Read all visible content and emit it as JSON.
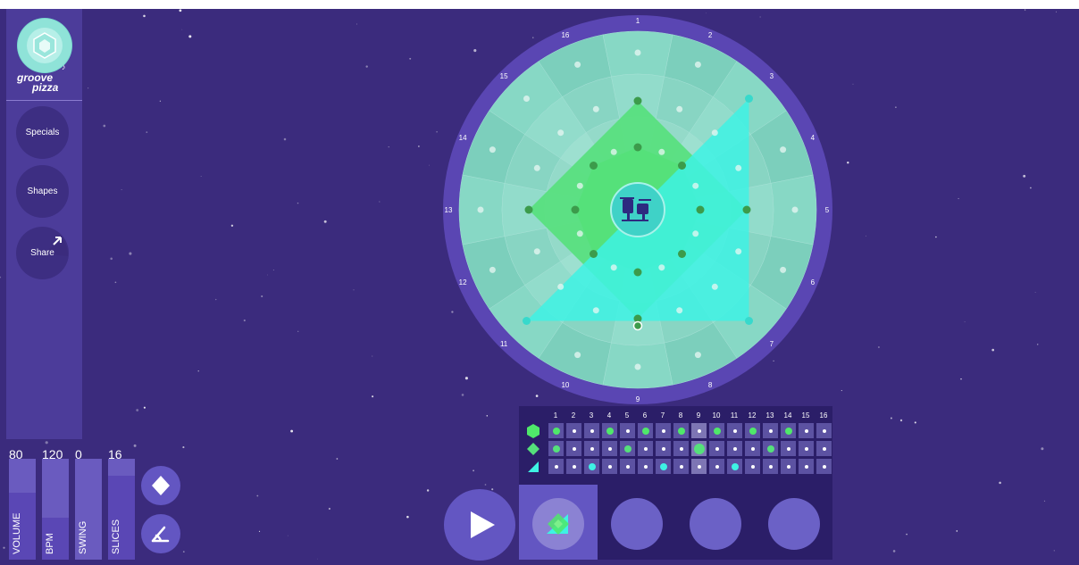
{
  "app": {
    "logo_line1": "groove",
    "logo_line2": "pizza"
  },
  "sidebar": {
    "buttons": [
      {
        "label": "Specials"
      },
      {
        "label": "Shapes"
      },
      {
        "label": "Share"
      }
    ]
  },
  "sliders": [
    {
      "label": "VOLUME",
      "value": "80",
      "level": 0.8
    },
    {
      "label": "BPM",
      "value": "120",
      "level": 0.5
    },
    {
      "label": "SWING",
      "value": "0",
      "level": 0.0
    },
    {
      "label": "SLICES",
      "value": "16",
      "level": 1.0
    }
  ],
  "shape_buttons": [
    {
      "icon": "diamond-icon"
    },
    {
      "icon": "triangle-icon"
    }
  ],
  "pizza": {
    "slices": 16,
    "slice_labels": [
      "1",
      "2",
      "3",
      "4",
      "5",
      "6",
      "7",
      "8",
      "9",
      "10",
      "11",
      "12",
      "13",
      "14",
      "15",
      "16"
    ],
    "center_icon": "drum-kit-icon",
    "ring_shapes": [
      {
        "ring": "inner",
        "shape": "octagon",
        "color": "#4fe86a",
        "vertices": [
          1,
          3,
          5,
          7,
          9,
          11,
          13,
          15
        ]
      },
      {
        "ring": "middle",
        "shape": "diamond",
        "color": "#55e07b",
        "vertices": [
          1,
          5,
          9,
          13
        ]
      },
      {
        "ring": "outer",
        "shape": "triangle",
        "color": "#3ef2e4",
        "vertices": [
          3,
          7,
          11
        ]
      }
    ]
  },
  "sequencer": {
    "column_numbers": [
      "1",
      "2",
      "3",
      "4",
      "5",
      "6",
      "7",
      "8",
      "9",
      "10",
      "11",
      "12",
      "13",
      "14",
      "15",
      "16"
    ],
    "playhead": 9,
    "rows": [
      {
        "icon": "hexagon-icon",
        "color": "#4fe86a",
        "steps": [
          1,
          0,
          0,
          1,
          0,
          1,
          0,
          1,
          0,
          1,
          0,
          1,
          0,
          1,
          0,
          0
        ]
      },
      {
        "icon": "diamond-icon",
        "color": "#55e07b",
        "steps": [
          1,
          0,
          0,
          0,
          1,
          0,
          0,
          0,
          1,
          0,
          0,
          0,
          1,
          0,
          0,
          0
        ]
      },
      {
        "icon": "triangle-icon",
        "color": "#3ef2e4",
        "steps": [
          0,
          0,
          1,
          0,
          0,
          0,
          1,
          0,
          0,
          0,
          1,
          0,
          0,
          0,
          0,
          0
        ]
      }
    ]
  },
  "transport": {
    "play_icon": "play-icon"
  },
  "pattern_tabs": [
    {
      "active": true,
      "icon": "pattern-thumbnail-icon"
    },
    {
      "active": false
    },
    {
      "active": false
    },
    {
      "active": false
    }
  ],
  "colors": {
    "background": "#3b2b7d",
    "sidebar": "#4c3c9a",
    "accent_green": "#4fe86a",
    "accent_cyan": "#3ef2e4",
    "panel": "#2b1e68"
  }
}
